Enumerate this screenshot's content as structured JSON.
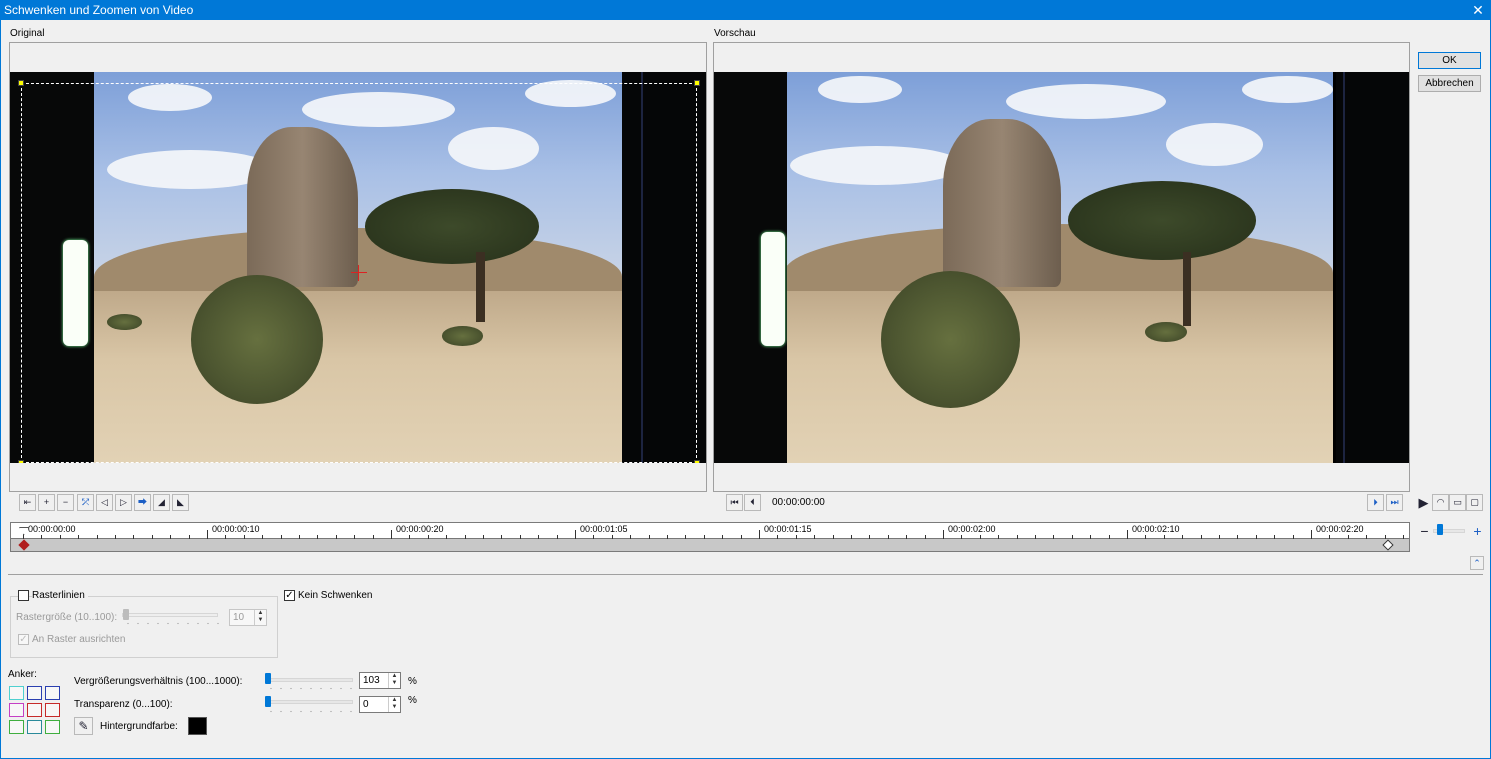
{
  "window": {
    "title": "Schwenken und Zoomen von Video"
  },
  "panes": {
    "original_label": "Original",
    "preview_label": "Vorschau"
  },
  "buttons": {
    "ok": "OK",
    "cancel": "Abbrechen"
  },
  "playback": {
    "timecode": "00:00:00:00"
  },
  "timeline": {
    "ticks": [
      "00:00:00:00",
      "00:00:00:10",
      "00:00:00:20",
      "00:00:01:05",
      "00:00:01:15",
      "00:00:02:00",
      "00:00:02:10",
      "00:00:02:20"
    ]
  },
  "grid": {
    "label": "Rasterlinien",
    "checked": false,
    "size_label": "Rastergröße (10..100):",
    "size_value": "10",
    "snap_label": "An Raster ausrichten",
    "snap_checked": true
  },
  "no_pan": {
    "label": "Kein Schwenken",
    "checked": true
  },
  "anchor": {
    "label": "Anker:"
  },
  "zoom": {
    "label": "Vergrößerungsverhältnis (100...1000):",
    "value": "103",
    "unit": "%"
  },
  "transparency": {
    "label": "Transparenz (0...100):",
    "value": "0",
    "unit": "%"
  },
  "background": {
    "label": "Hintergrundfarbe:",
    "color": "#000000"
  }
}
